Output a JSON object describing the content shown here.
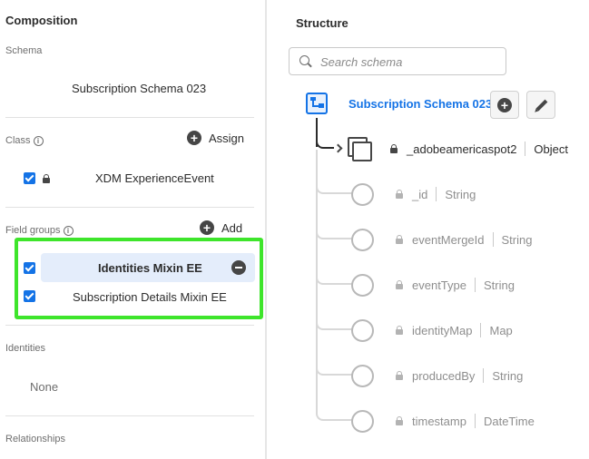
{
  "composition": {
    "title": "Composition",
    "schema_label": "Schema",
    "schema_name": "Subscription Schema 023",
    "class_label": "Class",
    "assign_label": "Assign",
    "class_name": "XDM ExperienceEvent",
    "field_groups_label": "Field groups",
    "add_label": "Add",
    "field_groups": [
      {
        "name": "Identities Mixin EE",
        "checked": true,
        "selected": true
      },
      {
        "name": "Subscription Details Mixin EE",
        "checked": true,
        "selected": false
      }
    ],
    "identities_label": "Identities",
    "identities_value": "None",
    "relationships_label": "Relationships"
  },
  "structure": {
    "title": "Structure",
    "search_placeholder": "Search schema",
    "root_name": "Subscription Schema 023",
    "object_field": {
      "name": "_adobeamericaspot2",
      "type": "Object"
    },
    "fields": [
      {
        "name": "_id",
        "type": "String"
      },
      {
        "name": "eventMergeId",
        "type": "String"
      },
      {
        "name": "eventType",
        "type": "String"
      },
      {
        "name": "identityMap",
        "type": "Map"
      },
      {
        "name": "producedBy",
        "type": "String"
      },
      {
        "name": "timestamp",
        "type": "DateTime"
      }
    ]
  },
  "colors": {
    "accent": "#1473e6",
    "highlight_border": "#3ee52b",
    "selected_bg": "#e4edfb"
  }
}
